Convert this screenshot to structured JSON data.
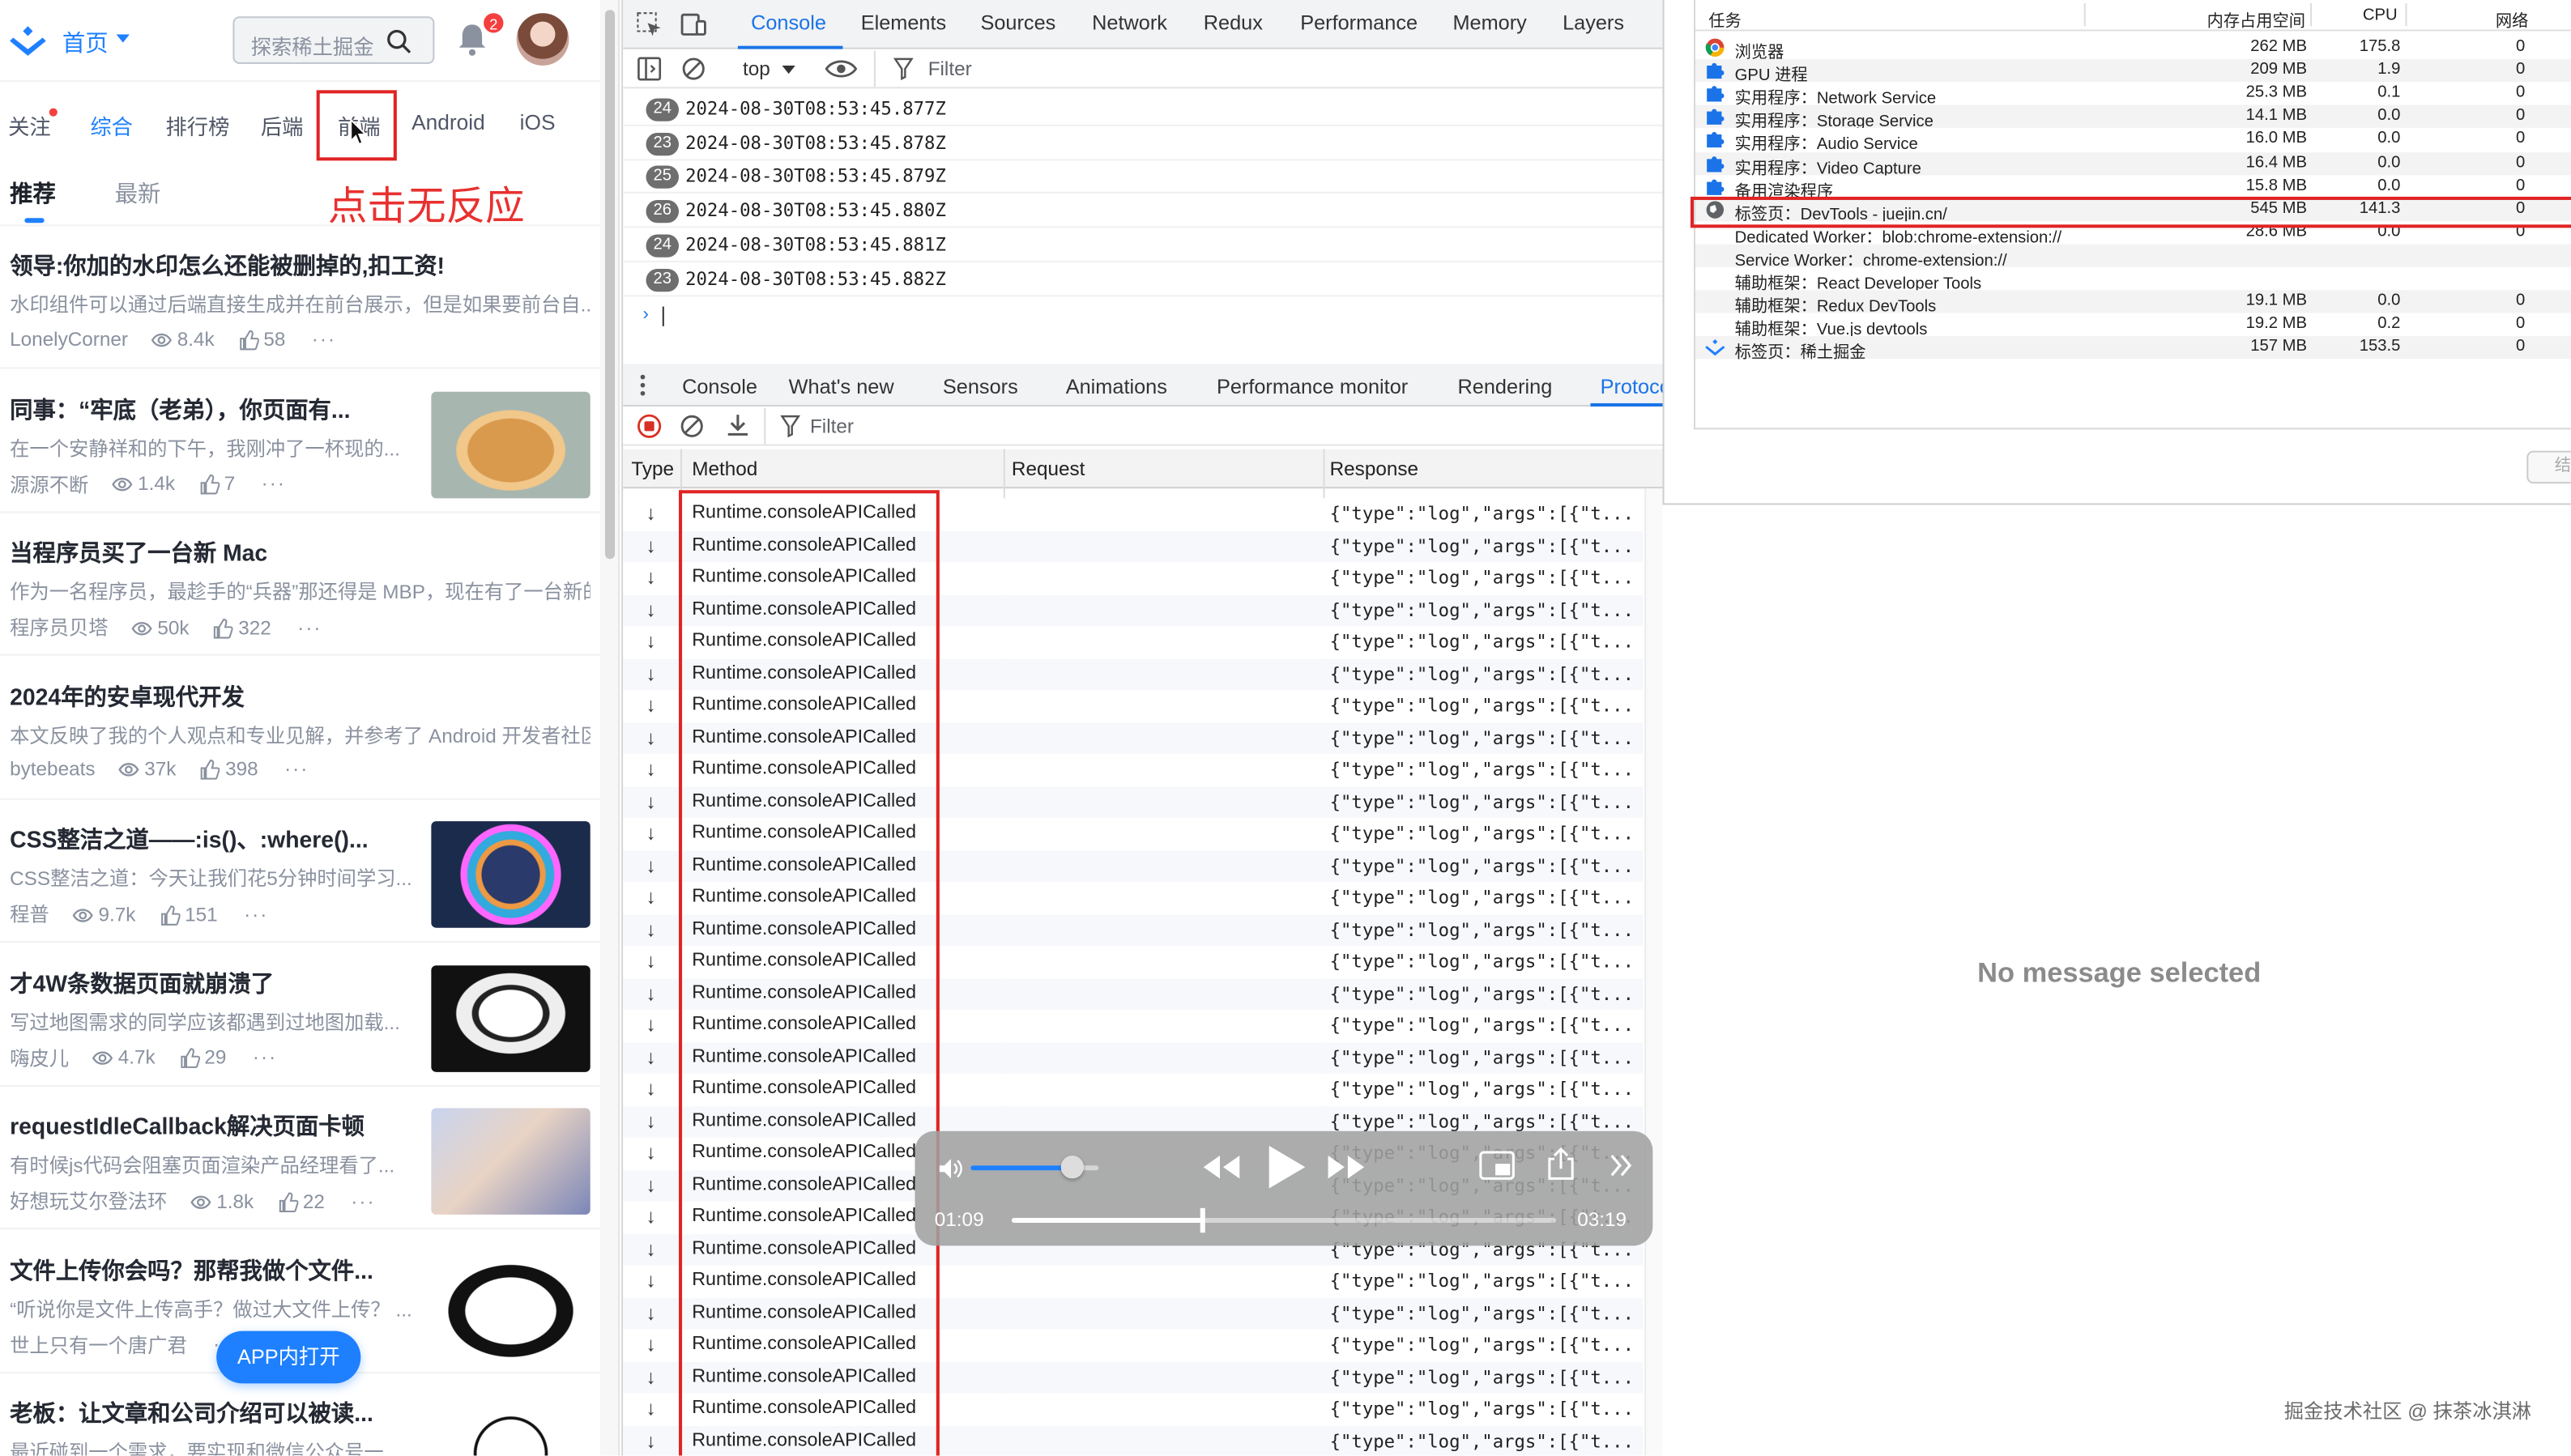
{
  "juejin": {
    "home_label": "首页",
    "search_placeholder": "探索稀土掘金",
    "notification_count": "2",
    "nav_tabs": [
      "关注",
      "综合",
      "排行榜",
      "后端",
      "前端",
      "Android",
      "iOS"
    ],
    "annotation": "点击无反应",
    "sub_tabs": [
      "推荐",
      "最新"
    ],
    "articles": [
      {
        "title": "领导:你加的水印怎么还能被删掉的,扣工资!",
        "desc": "水印组件可以通过后端直接生成并在前台展示，但是如果要前台自...",
        "author": "LonelyCorner",
        "views": "8.4k",
        "likes": "58",
        "more": "···"
      },
      {
        "title": "同事：“牢底（老弟），你页面有...",
        "desc": "在一个安静祥和的下午，我刚冲了一杯现的...",
        "author": "源源不断",
        "views": "1.4k",
        "likes": "7",
        "more": "···"
      },
      {
        "title": "当程序员买了一台新 Mac",
        "desc": "作为一名程序员，最趁手的“兵器”那还得是 MBP，现在有了一台新的 M...",
        "author": "程序员贝塔",
        "views": "50k",
        "likes": "322",
        "more": "···"
      },
      {
        "title": "2024年的安卓现代开发",
        "desc": "本文反映了我的个人观点和专业见解，并参考了 Android 开发者社区...",
        "author": "bytebeats",
        "views": "37k",
        "likes": "398",
        "more": "···"
      },
      {
        "title": "CSS整洁之道——:is()、:where()...",
        "desc": "CSS整洁之道：今天让我们花5分钟时间学习...",
        "author": "程普",
        "views": "9.7k",
        "likes": "151",
        "more": "···"
      },
      {
        "title": "才4W条数据页面就崩溃了",
        "desc": "写过地图需求的同学应该都遇到过地图加载...",
        "author": "嗨皮儿",
        "views": "4.7k",
        "likes": "29",
        "more": "···"
      },
      {
        "title": "requestIdleCallback解决页面卡顿",
        "desc": "有时候js代码会阻塞页面渲染产品经理看了...",
        "author": "好想玩艾尔登法环",
        "views": "1.8k",
        "likes": "22",
        "more": "···"
      },
      {
        "title": "文件上传你会吗？那帮我做个文件...",
        "desc": "“听说你是文件上传高手？做过大文件上传？ ...",
        "author": "世上只有一个唐广君",
        "views": "",
        "likes": "",
        "more": "···"
      },
      {
        "title": "老板：让文章和公司介绍可以被读...",
        "desc": "最近碰到一个需求，要实现和微信公众号一...",
        "author": "",
        "views": "",
        "likes": "",
        "more": ""
      }
    ],
    "app_button": "APP内打开"
  },
  "devtools": {
    "main_tabs": [
      "Console",
      "Elements",
      "Sources",
      "Network",
      "Redux",
      "Performance",
      "Memory",
      "Layers"
    ],
    "context": "top",
    "filter_placeholder": "Filter",
    "logs": [
      {
        "count": "24",
        "text": "2024-08-30T08:53:45.877Z"
      },
      {
        "count": "23",
        "text": "2024-08-30T08:53:45.878Z"
      },
      {
        "count": "25",
        "text": "2024-08-30T08:53:45.879Z"
      },
      {
        "count": "26",
        "text": "2024-08-30T08:53:45.880Z"
      },
      {
        "count": "24",
        "text": "2024-08-30T08:53:45.881Z"
      },
      {
        "count": "23",
        "text": "2024-08-30T08:53:45.882Z"
      }
    ],
    "drawer_tabs": [
      "Console",
      "What's new",
      "Sensors",
      "Animations",
      "Performance monitor",
      "Rendering",
      "Protoco"
    ],
    "proto_filter": "Filter",
    "columns": [
      "Type",
      "Method",
      "Request",
      "Response"
    ],
    "method": "Runtime.consoleAPICalled",
    "response": "{\"type\":\"log\",\"args\":[{\"t...",
    "arrow": "↓"
  },
  "media": {
    "elapsed": "01:09",
    "total": "03:19",
    "progress": 0.35,
    "volume": 0.8
  },
  "taskmgr": {
    "columns": [
      "任务",
      "内存占用空间",
      "CPU",
      "网络"
    ],
    "rows": [
      {
        "name": "浏览器",
        "mem": "262 MB",
        "cpu": "175.8",
        "net": "0",
        "icon": "chrome-icon"
      },
      {
        "name": "GPU 进程",
        "mem": "209 MB",
        "cpu": "1.9",
        "net": "0",
        "icon": "puzzle-icon"
      },
      {
        "name": "实用程序：Network Service",
        "mem": "25.3 MB",
        "cpu": "0.1",
        "net": "0",
        "icon": "puzzle-icon"
      },
      {
        "name": "实用程序：Storage Service",
        "mem": "14.1 MB",
        "cpu": "0.0",
        "net": "0",
        "icon": "puzzle-icon"
      },
      {
        "name": "实用程序：Audio Service",
        "mem": "16.0 MB",
        "cpu": "0.0",
        "net": "0",
        "icon": "puzzle-icon"
      },
      {
        "name": "实用程序：Video Capture",
        "mem": "16.4 MB",
        "cpu": "0.0",
        "net": "0",
        "icon": "puzzle-icon"
      },
      {
        "name": "备用渲染程序",
        "mem": "15.8 MB",
        "cpu": "0.0",
        "net": "0",
        "icon": "puzzle-icon"
      },
      {
        "name": "标签页：DevTools - juejin.cn/",
        "mem": "545 MB",
        "cpu": "141.3",
        "net": "0",
        "icon": "globe-icon",
        "highlight": true
      },
      {
        "name": "Dedicated Worker：blob:chrome-extension://",
        "mem": "28.6 MB",
        "cpu": "0.0",
        "net": "0",
        "icon": "",
        "indent": true
      },
      {
        "name": "Service Worker：chrome-extension://",
        "mem": "",
        "cpu": "",
        "net": "",
        "icon": "",
        "indent": true
      },
      {
        "name": "辅助框架：React Developer Tools",
        "mem": "",
        "cpu": "",
        "net": "",
        "icon": "",
        "indent": true
      },
      {
        "name": "辅助框架：Redux DevTools",
        "mem": "19.1 MB",
        "cpu": "0.0",
        "net": "0",
        "icon": "",
        "indent": true
      },
      {
        "name": "辅助框架：Vue.js devtools",
        "mem": "19.2 MB",
        "cpu": "0.2",
        "net": "0",
        "icon": "",
        "indent": true
      },
      {
        "name": "标签页：稀土掘金",
        "mem": "157 MB",
        "cpu": "153.5",
        "net": "0",
        "icon": "juejin-icon"
      }
    ],
    "end_button": "结"
  },
  "detail_placeholder": "No message selected",
  "watermark": "掘金技术社区 @ 抹茶冰淇淋",
  "colors": {
    "brand": "#1e80ff",
    "annotation": "#e02424",
    "devtools_accent": "#1a73e8"
  }
}
